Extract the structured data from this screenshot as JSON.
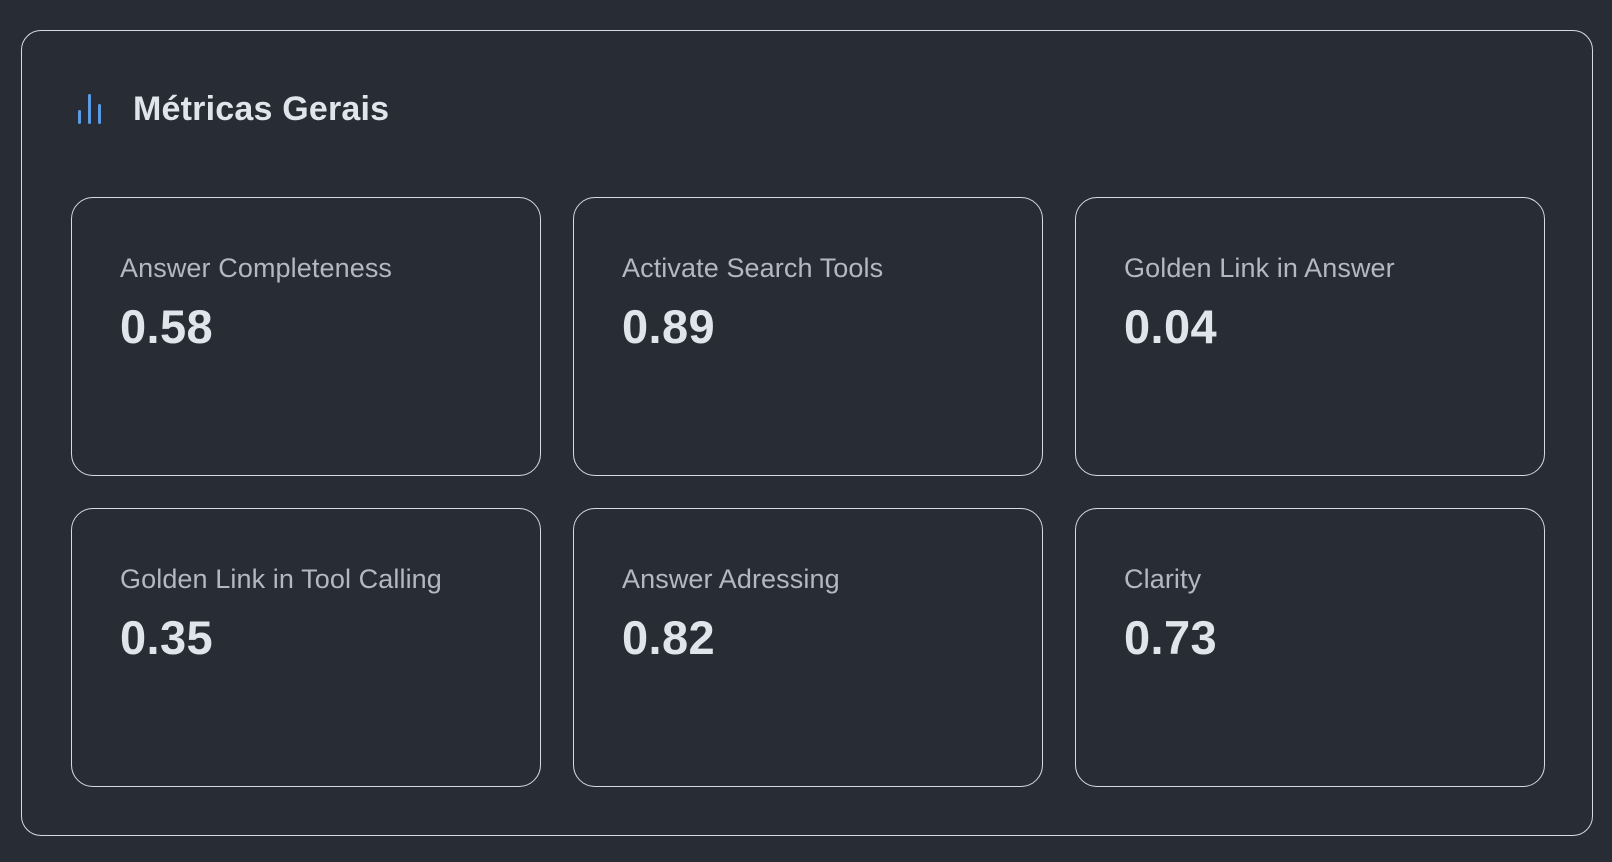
{
  "panel": {
    "title": "Métricas Gerais",
    "icon": "bar-chart-icon"
  },
  "metrics": [
    {
      "label": "Answer Completeness",
      "value": "0.58"
    },
    {
      "label": "Activate Search Tools",
      "value": "0.89"
    },
    {
      "label": "Golden Link in Answer",
      "value": "0.04"
    },
    {
      "label": "Golden Link in Tool Calling",
      "value": "0.35"
    },
    {
      "label": "Answer Adressing",
      "value": "0.82"
    },
    {
      "label": "Clarity",
      "value": "0.73"
    }
  ],
  "colors": {
    "background": "#282c34",
    "border": "#d7dae0",
    "accent": "#5b9be6",
    "label": "#b3b8c2",
    "value": "#e1e4ea"
  }
}
